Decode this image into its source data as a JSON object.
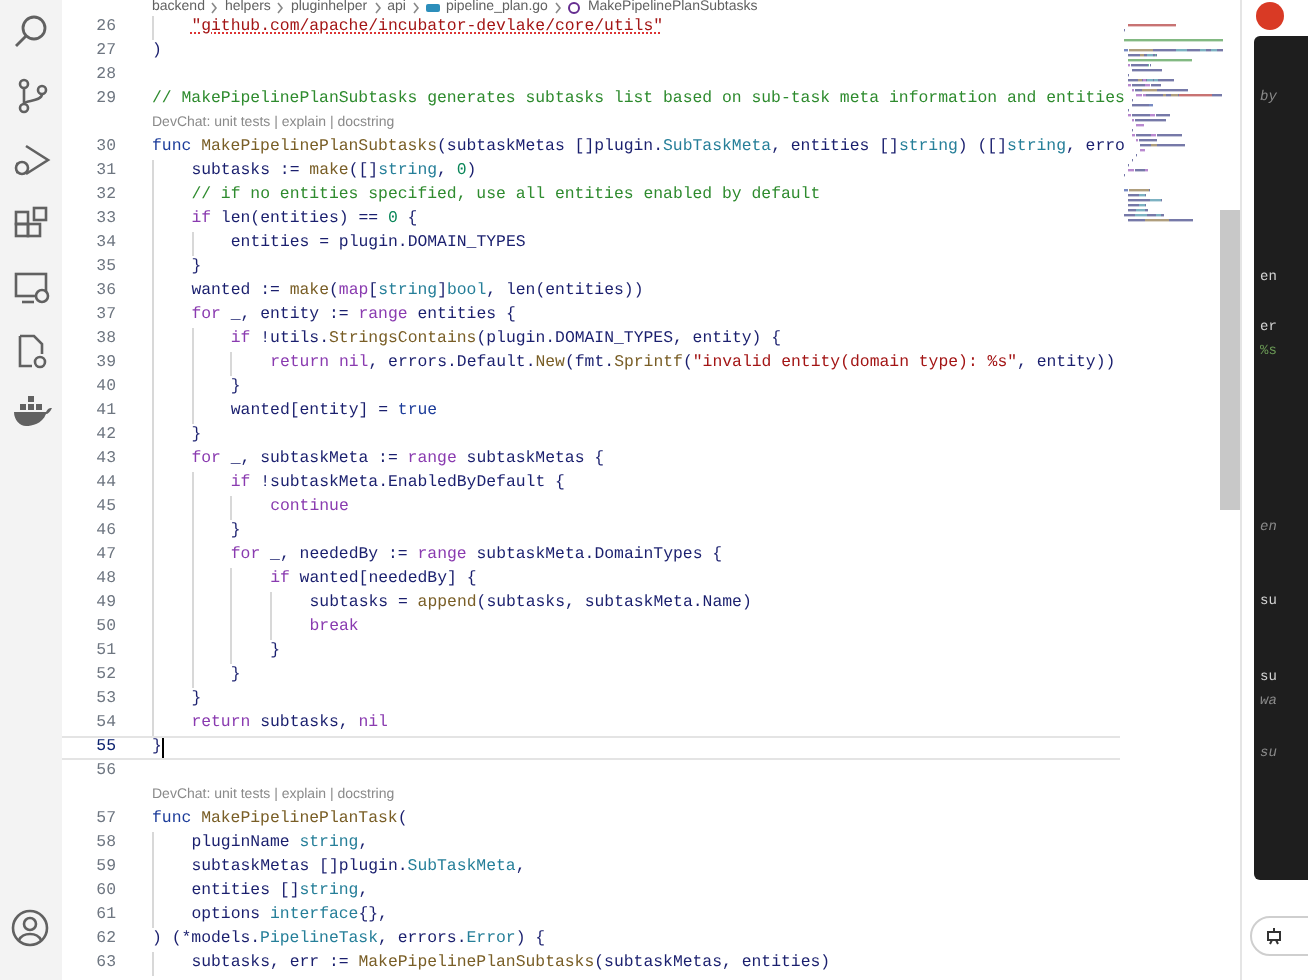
{
  "breadcrumb": {
    "items": [
      {
        "kind": "folder",
        "label": "backend"
      },
      {
        "kind": "folder",
        "label": "helpers"
      },
      {
        "kind": "folder",
        "label": "pluginhelper"
      },
      {
        "kind": "folder",
        "label": "api"
      },
      {
        "kind": "file",
        "label": "pipeline_plan.go"
      },
      {
        "kind": "symbol",
        "label": "MakePipelinePlanSubtasks"
      }
    ]
  },
  "editor": {
    "lines": [
      {
        "kind": "code",
        "number": "26",
        "current": false,
        "tokens": [
          {
            "kind": "string",
            "text": "    \"github.com/apache/incubator-devlake/core/utils\""
          }
        ]
      },
      {
        "kind": "code",
        "number": "27",
        "current": false,
        "tokens": [
          {
            "kind": "plain",
            "text": ")"
          }
        ]
      },
      {
        "kind": "code",
        "number": "28",
        "current": false
      },
      {
        "kind": "code",
        "number": "29",
        "current": false,
        "tokens": [
          {
            "kind": "comment",
            "text": "// MakePipelinePlanSubtasks generates subtasks list based on sub-task meta information and entities"
          }
        ]
      },
      {
        "kind": "codelens",
        "text": "DevChat: unit tests | explain | docstring"
      },
      {
        "kind": "code",
        "number": "30",
        "current": false,
        "tokens": [
          {
            "kind": "declaration",
            "text": "func"
          },
          {
            "kind": "function",
            "text": " MakePipelinePlanSubtasks"
          },
          {
            "kind": "plain",
            "text": "(subtaskMetas []plugin."
          },
          {
            "kind": "type",
            "text": "SubTaskMeta"
          },
          {
            "kind": "plain",
            "text": ", entities []"
          },
          {
            "kind": "type",
            "text": "string"
          },
          {
            "kind": "plain",
            "text": ") ([]"
          },
          {
            "kind": "type",
            "text": "string"
          },
          {
            "kind": "plain",
            "text": ", erro"
          }
        ]
      },
      {
        "kind": "code",
        "number": "31",
        "current": false,
        "tokens": [
          {
            "kind": "plain",
            "text": "    subtasks := "
          },
          {
            "kind": "builtin",
            "text": "make"
          },
          {
            "kind": "plain",
            "text": "([]"
          },
          {
            "kind": "type",
            "text": "string"
          },
          {
            "kind": "plain",
            "text": ", "
          },
          {
            "kind": "number",
            "text": "0"
          },
          {
            "kind": "plain",
            "text": ")"
          }
        ]
      },
      {
        "kind": "code",
        "number": "32",
        "current": false,
        "tokens": [
          {
            "kind": "comment",
            "text": "    // if no entities specified, use all entities enabled by default"
          }
        ]
      },
      {
        "kind": "code",
        "number": "33",
        "current": false,
        "tokens": [
          {
            "kind": "keyword",
            "text": "    if"
          },
          {
            "kind": "plain",
            "text": " len(entities) == "
          },
          {
            "kind": "number",
            "text": "0"
          },
          {
            "kind": "plain",
            "text": " {"
          }
        ]
      },
      {
        "kind": "code",
        "number": "34",
        "current": false,
        "tokens": [
          {
            "kind": "plain",
            "text": "        entities = plugin.DOMAIN_TYPES"
          }
        ]
      },
      {
        "kind": "code",
        "number": "35",
        "current": false,
        "tokens": [
          {
            "kind": "plain",
            "text": "    }"
          }
        ]
      },
      {
        "kind": "code",
        "number": "36",
        "current": false,
        "tokens": [
          {
            "kind": "plain",
            "text": "    wanted := "
          },
          {
            "kind": "builtin",
            "text": "make"
          },
          {
            "kind": "plain",
            "text": "("
          },
          {
            "kind": "keyword",
            "text": "map"
          },
          {
            "kind": "plain",
            "text": "["
          },
          {
            "kind": "type",
            "text": "string"
          },
          {
            "kind": "plain",
            "text": "]"
          },
          {
            "kind": "type",
            "text": "bool"
          },
          {
            "kind": "plain",
            "text": ", len(entities))"
          }
        ]
      },
      {
        "kind": "code",
        "number": "37",
        "current": false,
        "tokens": [
          {
            "kind": "keyword",
            "text": "    for"
          },
          {
            "kind": "plain",
            "text": " _, entity := "
          },
          {
            "kind": "keyword",
            "text": "range"
          },
          {
            "kind": "plain",
            "text": " entities {"
          }
        ]
      },
      {
        "kind": "code",
        "number": "38",
        "current": false,
        "tokens": [
          {
            "kind": "keyword",
            "text": "        if"
          },
          {
            "kind": "plain",
            "text": " !utils."
          },
          {
            "kind": "function",
            "text": "StringsContains"
          },
          {
            "kind": "plain",
            "text": "(plugin.DOMAIN_TYPES, entity) {"
          }
        ]
      },
      {
        "kind": "code",
        "number": "39",
        "current": false,
        "tokens": [
          {
            "kind": "keyword",
            "text": "            return"
          },
          {
            "kind": "keyword",
            "text": " nil"
          },
          {
            "kind": "plain",
            "text": ", errors.Default."
          },
          {
            "kind": "function",
            "text": "New"
          },
          {
            "kind": "plain",
            "text": "(fmt."
          },
          {
            "kind": "function",
            "text": "Sprintf"
          },
          {
            "kind": "plain",
            "text": "("
          },
          {
            "kind": "string",
            "text": "\"invalid entity(domain type): %s\""
          },
          {
            "kind": "plain",
            "text": ", entity))"
          }
        ]
      },
      {
        "kind": "code",
        "number": "40",
        "current": false,
        "tokens": [
          {
            "kind": "plain",
            "text": "        }"
          }
        ]
      },
      {
        "kind": "code",
        "number": "41",
        "current": false,
        "tokens": [
          {
            "kind": "plain",
            "text": "        wanted[entity] = "
          },
          {
            "kind": "constant",
            "text": "true"
          }
        ]
      },
      {
        "kind": "code",
        "number": "42",
        "current": false,
        "tokens": [
          {
            "kind": "plain",
            "text": "    }"
          }
        ]
      },
      {
        "kind": "code",
        "number": "43",
        "current": false,
        "tokens": [
          {
            "kind": "keyword",
            "text": "    for"
          },
          {
            "kind": "plain",
            "text": " _, subtaskMeta := "
          },
          {
            "kind": "keyword",
            "text": "range"
          },
          {
            "kind": "plain",
            "text": " subtaskMetas {"
          }
        ]
      },
      {
        "kind": "code",
        "number": "44",
        "current": false,
        "tokens": [
          {
            "kind": "keyword",
            "text": "        if"
          },
          {
            "kind": "plain",
            "text": " !subtaskMeta.EnabledByDefault {"
          }
        ]
      },
      {
        "kind": "code",
        "number": "45",
        "current": false,
        "tokens": [
          {
            "kind": "keyword",
            "text": "            continue"
          }
        ]
      },
      {
        "kind": "code",
        "number": "46",
        "current": false,
        "tokens": [
          {
            "kind": "plain",
            "text": "        }"
          }
        ]
      },
      {
        "kind": "code",
        "number": "47",
        "current": false,
        "tokens": [
          {
            "kind": "keyword",
            "text": "        for"
          },
          {
            "kind": "plain",
            "text": " _, neededBy := "
          },
          {
            "kind": "keyword",
            "text": "range"
          },
          {
            "kind": "plain",
            "text": " subtaskMeta.DomainTypes {"
          }
        ]
      },
      {
        "kind": "code",
        "number": "48",
        "current": false,
        "tokens": [
          {
            "kind": "keyword",
            "text": "            if"
          },
          {
            "kind": "plain",
            "text": " wanted[neededBy] {"
          }
        ]
      },
      {
        "kind": "code",
        "number": "49",
        "current": false,
        "tokens": [
          {
            "kind": "plain",
            "text": "                subtasks = "
          },
          {
            "kind": "builtin",
            "text": "append"
          },
          {
            "kind": "plain",
            "text": "(subtasks, subtaskMeta.Name)"
          }
        ]
      },
      {
        "kind": "code",
        "number": "50",
        "current": false,
        "tokens": [
          {
            "kind": "keyword",
            "text": "                break"
          }
        ]
      },
      {
        "kind": "code",
        "number": "51",
        "current": false,
        "tokens": [
          {
            "kind": "plain",
            "text": "            }"
          }
        ]
      },
      {
        "kind": "code",
        "number": "52",
        "current": false,
        "tokens": [
          {
            "kind": "plain",
            "text": "        }"
          }
        ]
      },
      {
        "kind": "code",
        "number": "53",
        "current": false,
        "tokens": [
          {
            "kind": "plain",
            "text": "    }"
          }
        ]
      },
      {
        "kind": "code",
        "number": "54",
        "current": false,
        "tokens": [
          {
            "kind": "keyword",
            "text": "    return"
          },
          {
            "kind": "plain",
            "text": " subtasks, "
          },
          {
            "kind": "keyword",
            "text": "nil"
          }
        ]
      },
      {
        "kind": "code",
        "number": "55",
        "current": true,
        "tokens": [
          {
            "kind": "plain",
            "text": "}"
          }
        ]
      },
      {
        "kind": "code",
        "number": "56",
        "current": false
      },
      {
        "kind": "codelens",
        "text": "DevChat: unit tests | explain | docstring"
      },
      {
        "kind": "code",
        "number": "57",
        "current": false,
        "tokens": [
          {
            "kind": "declaration",
            "text": "func"
          },
          {
            "kind": "function",
            "text": " MakePipelinePlanTask"
          },
          {
            "kind": "plain",
            "text": "("
          }
        ]
      },
      {
        "kind": "code",
        "number": "58",
        "current": false,
        "tokens": [
          {
            "kind": "plain",
            "text": "    pluginName "
          },
          {
            "kind": "type",
            "text": "string"
          },
          {
            "kind": "plain",
            "text": ","
          }
        ]
      },
      {
        "kind": "code",
        "number": "59",
        "current": false,
        "tokens": [
          {
            "kind": "plain",
            "text": "    subtaskMetas []plugin."
          },
          {
            "kind": "type",
            "text": "SubTaskMeta"
          },
          {
            "kind": "plain",
            "text": ","
          }
        ]
      },
      {
        "kind": "code",
        "number": "60",
        "current": false,
        "tokens": [
          {
            "kind": "plain",
            "text": "    entities []"
          },
          {
            "kind": "type",
            "text": "string"
          },
          {
            "kind": "plain",
            "text": ","
          }
        ]
      },
      {
        "kind": "code",
        "number": "61",
        "current": false,
        "tokens": [
          {
            "kind": "plain",
            "text": "    options "
          },
          {
            "kind": "type",
            "text": "interface"
          },
          {
            "kind": "plain",
            "text": "{},"
          }
        ]
      },
      {
        "kind": "code",
        "number": "62",
        "current": false,
        "tokens": [
          {
            "kind": "plain",
            "text": ") (*models."
          },
          {
            "kind": "type",
            "text": "PipelineTask"
          },
          {
            "kind": "plain",
            "text": ", errors."
          },
          {
            "kind": "type",
            "text": "Error"
          },
          {
            "kind": "plain",
            "text": ") {"
          }
        ]
      },
      {
        "kind": "code",
        "number": "63",
        "current": false,
        "tokens": [
          {
            "kind": "plain",
            "text": "    subtasks, err := "
          },
          {
            "kind": "function",
            "text": "MakePipelinePlanSubtasks"
          },
          {
            "kind": "plain",
            "text": "(subtaskMetas, entities)"
          }
        ]
      }
    ]
  },
  "chat_panel": {
    "fragments": [
      {
        "kind": "comment",
        "text": "by"
      },
      {
        "kind": "plain",
        "text": "en"
      },
      {
        "kind": "plain",
        "text": "er"
      },
      {
        "kind": "string",
        "text": "%s"
      },
      {
        "kind": "comment",
        "text": "en"
      },
      {
        "kind": "plain",
        "text": "su"
      },
      {
        "kind": "plain",
        "text": "su"
      },
      {
        "kind": "comment",
        "text": "wa"
      },
      {
        "kind": "comment",
        "text": "su"
      }
    ]
  }
}
